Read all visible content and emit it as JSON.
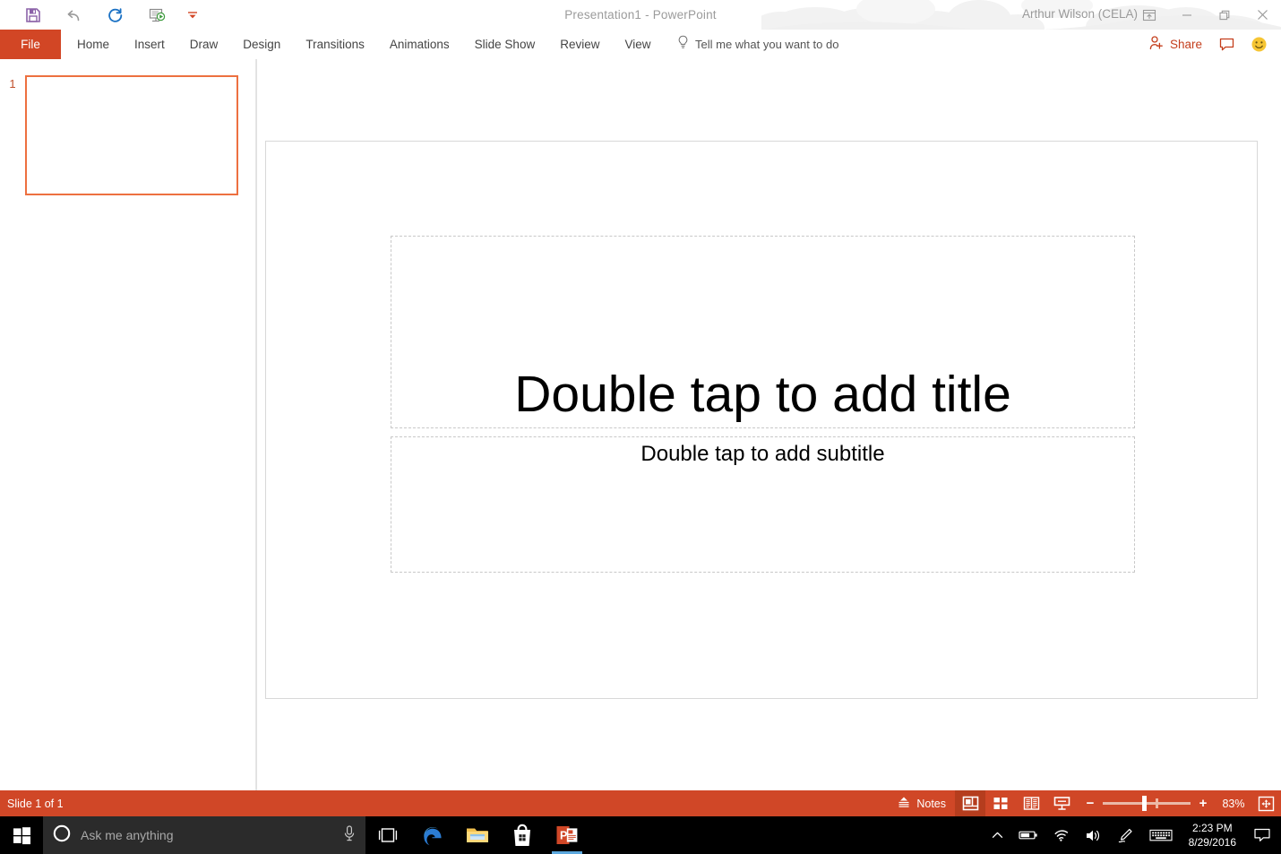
{
  "window": {
    "title": "Presentation1  -  PowerPoint",
    "account_name": "Arthur Wilson (CELA)",
    "ribbon_display_options_icon": "ribbon-display-options-icon",
    "minimize_icon": "minimize-icon",
    "restore_icon": "restore-icon",
    "close_icon": "close-icon"
  },
  "quick_access": {
    "items": [
      {
        "name": "save",
        "icon": "save-icon",
        "tooltip": "Save"
      },
      {
        "name": "undo",
        "icon": "undo-icon",
        "tooltip": "Undo"
      },
      {
        "name": "redo",
        "icon": "redo-icon",
        "tooltip": "Redo"
      },
      {
        "name": "start-from-beginning",
        "icon": "start-slideshow-icon",
        "tooltip": "Start From Beginning"
      },
      {
        "name": "customize",
        "icon": "chevron-down-icon",
        "tooltip": "Customize Quick Access Toolbar"
      }
    ]
  },
  "ribbon": {
    "file_tab": "File",
    "tabs": [
      {
        "label": "Home"
      },
      {
        "label": "Insert"
      },
      {
        "label": "Draw"
      },
      {
        "label": "Design"
      },
      {
        "label": "Transitions"
      },
      {
        "label": "Animations"
      },
      {
        "label": "Slide Show"
      },
      {
        "label": "Review"
      },
      {
        "label": "View"
      }
    ],
    "tell_me": "Tell me what you want to do",
    "share_label": "Share",
    "comments_icon": "comment-icon",
    "feedback_icon": "smiley-feedback-icon"
  },
  "thumbnails": {
    "slides": [
      {
        "number": "1",
        "selected": true
      }
    ]
  },
  "slide": {
    "title_placeholder": "Double tap to add title",
    "subtitle_placeholder": "Double tap to add subtitle"
  },
  "status_bar": {
    "slide_counter": "Slide 1 of 1",
    "notes_label": "Notes",
    "views": [
      {
        "name": "normal",
        "icon": "normal-view-icon",
        "active": true
      },
      {
        "name": "slide-sorter",
        "icon": "slide-sorter-icon",
        "active": false
      },
      {
        "name": "reading-view",
        "icon": "reading-view-icon",
        "active": false
      },
      {
        "name": "slide-show",
        "icon": "slide-show-icon",
        "active": false
      }
    ],
    "zoom_out": "−",
    "zoom_in": "+",
    "zoom_level": "83%",
    "fit_icon": "fit-slide-to-window-icon"
  },
  "taskbar": {
    "start_icon": "windows-start-icon",
    "search_placeholder": "Ask me anything",
    "cortana_icon": "cortana-circle-icon",
    "mic_icon": "microphone-icon",
    "task_view_icon": "task-view-icon",
    "apps": [
      {
        "name": "edge",
        "icon": "edge-icon",
        "running": false
      },
      {
        "name": "file-explorer",
        "icon": "file-explorer-icon",
        "running": false
      },
      {
        "name": "microsoft-store",
        "icon": "microsoft-store-icon",
        "running": false
      },
      {
        "name": "powerpoint",
        "icon": "powerpoint-icon",
        "running": true
      }
    ],
    "tray": [
      {
        "name": "show-hidden-icons",
        "icon": "chevron-up-icon"
      },
      {
        "name": "battery",
        "icon": "battery-icon"
      },
      {
        "name": "network",
        "icon": "wifi-icon"
      },
      {
        "name": "volume",
        "icon": "speaker-icon"
      },
      {
        "name": "ink-workspace",
        "icon": "pen-icon"
      },
      {
        "name": "touch-keyboard",
        "icon": "keyboard-icon"
      }
    ],
    "time": "2:23 PM",
    "date": "8/29/2016",
    "action_center_icon": "action-center-icon"
  },
  "colors": {
    "accent": "#d04727",
    "file_tab": "#d24625",
    "thumb_selected_border": "#ed7040",
    "share_text": "#c43e1c",
    "taskbar_bg": "#000000",
    "cortana_bg": "#2b2b2b",
    "taskbar_active_underline": "#5ca8de"
  }
}
